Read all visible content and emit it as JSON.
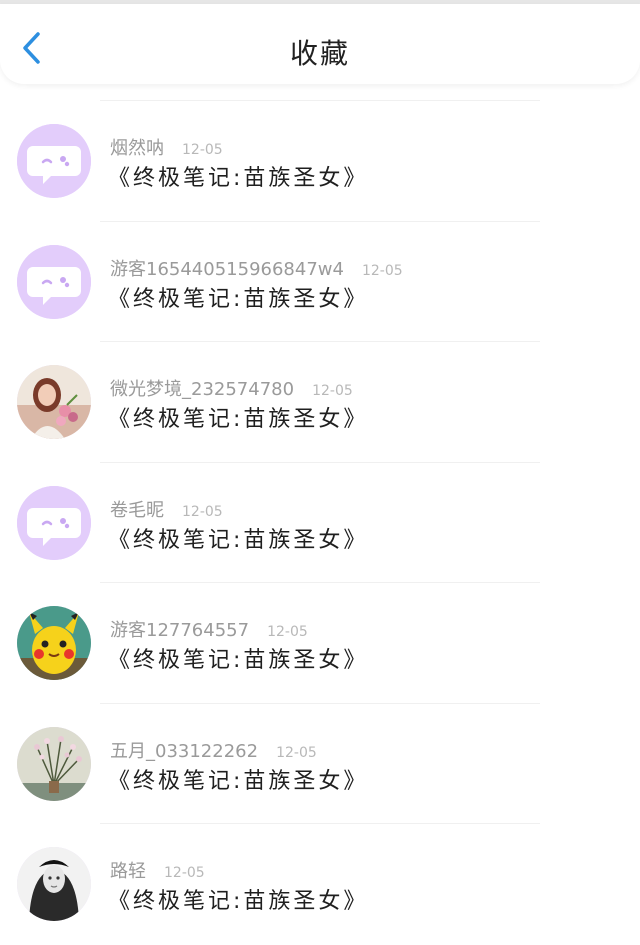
{
  "header": {
    "title": "收藏"
  },
  "items": [
    {
      "user": "烟然呐",
      "date": "12-05",
      "book": "《终极笔记:苗族圣女》",
      "avatar": "chat-bubble-icon"
    },
    {
      "user": "游客1654405159668​47w4",
      "date": "12-05",
      "book": "《终极笔记:苗族圣女》",
      "avatar": "chat-bubble-icon"
    },
    {
      "user": "微光梦境_232574780",
      "date": "12-05",
      "book": "《终极笔记:苗族圣女》",
      "avatar": "photo-woman-flowers"
    },
    {
      "user": "卷毛昵",
      "date": "12-05",
      "book": "《终极笔记:苗族圣女》",
      "avatar": "chat-bubble-icon"
    },
    {
      "user": "游客127764557",
      "date": "12-05",
      "book": "《终极笔记:苗族圣女》",
      "avatar": "photo-pikachu"
    },
    {
      "user": "五月_033122262",
      "date": "12-05",
      "book": "《终极笔记:苗族圣女》",
      "avatar": "photo-flower-vase"
    },
    {
      "user": "路轻",
      "date": "12-05",
      "book": "《终极笔记:苗族圣女》",
      "avatar": "photo-bw-woman"
    }
  ]
}
